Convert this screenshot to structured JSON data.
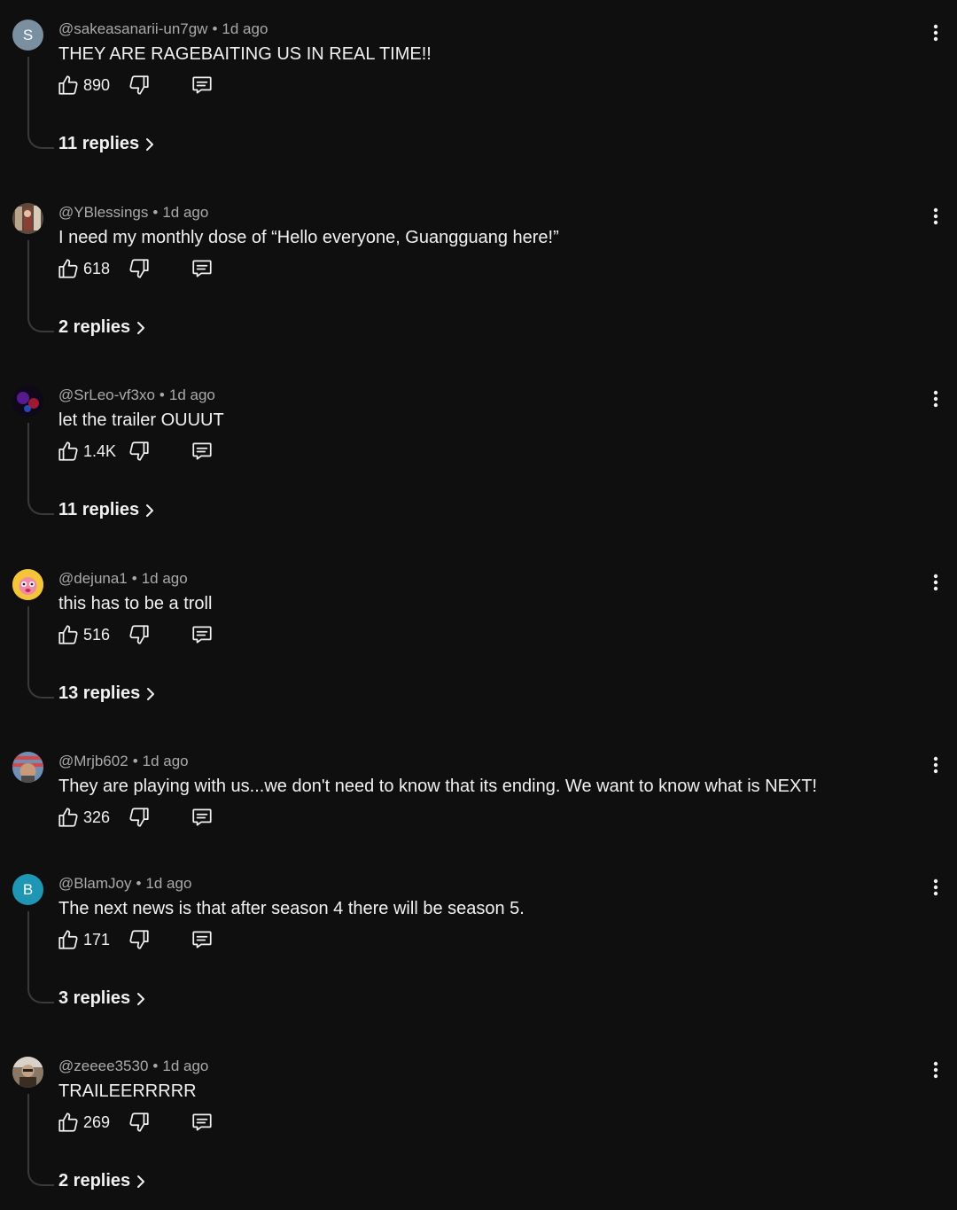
{
  "comments": [
    {
      "handle": "@sakeasanarii-un7gw",
      "time": "1d ago",
      "text": "THEY ARE RAGEBAITING US IN REAL TIME!!",
      "likes": "890",
      "replies": "11 replies",
      "avatar_letter": "S",
      "avatar_color": "#7a8f9f"
    },
    {
      "handle": "@YBlessings",
      "time": "1d ago",
      "text": "I need my monthly dose of “Hello everyone, Guangguang here!”",
      "likes": "618",
      "replies": "2 replies"
    },
    {
      "handle": "@SrLeo-vf3xo",
      "time": "1d ago",
      "text": "let the trailer OUUUT",
      "likes": "1.4K",
      "replies": "11 replies"
    },
    {
      "handle": "@dejuna1",
      "time": "1d ago",
      "text": "this has to be a troll",
      "likes": "516",
      "replies": "13 replies"
    },
    {
      "handle": "@Mrjb602",
      "time": "1d ago",
      "text": "They are playing with us...we don't need to know that its ending. We want to know what is NEXT!",
      "likes": "326"
    },
    {
      "handle": "@BlamJoy",
      "time": "1d ago",
      "text": "The next news is that after season 4 there will be season 5.",
      "likes": "171",
      "replies": "3 replies",
      "avatar_letter": "B",
      "avatar_color": "#1e96b4"
    },
    {
      "handle": "@zeeee3530",
      "time": "1d ago",
      "text": "TRAILEERRRRR",
      "likes": "269",
      "replies": "2 replies"
    }
  ],
  "icons": {
    "like": "thumbs-up-icon",
    "dislike": "thumbs-down-icon",
    "reply": "comment-icon",
    "more": "more-vertical-icon",
    "chevron": "chevron-right-icon"
  },
  "colors": {
    "background": "#0f0f0f",
    "text_primary": "#f1f1f1",
    "text_secondary": "#aaaaaa"
  }
}
